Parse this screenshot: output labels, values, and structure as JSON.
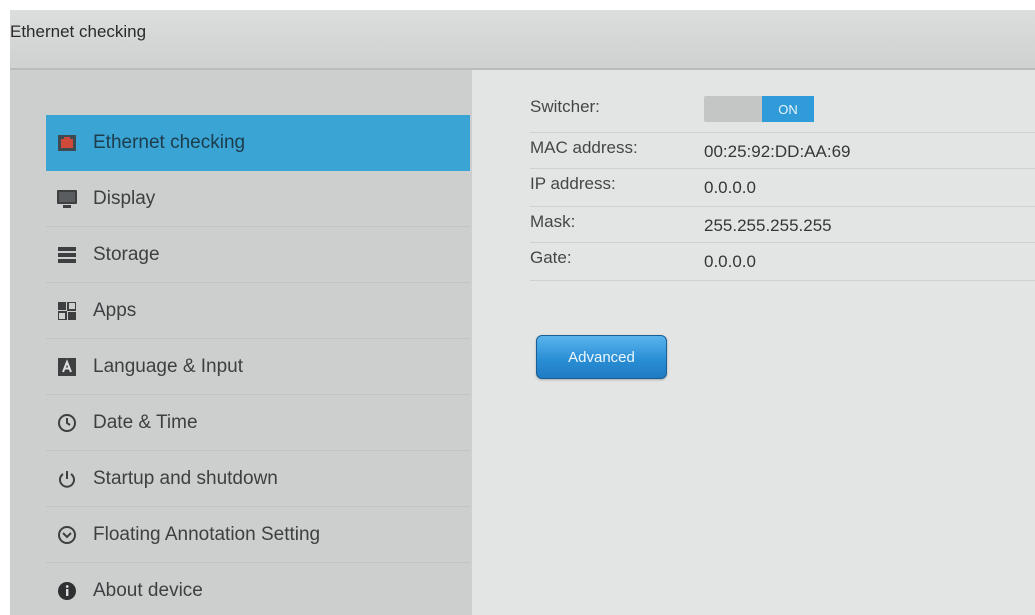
{
  "window": {
    "title": "Ethernet checking"
  },
  "sidebar": {
    "items": [
      {
        "label": "Ethernet checking",
        "icon": "ethernet-icon",
        "active": true
      },
      {
        "label": "Display",
        "icon": "display-icon",
        "active": false
      },
      {
        "label": "Storage",
        "icon": "storage-icon",
        "active": false
      },
      {
        "label": "Apps",
        "icon": "apps-icon",
        "active": false
      },
      {
        "label": "Language & Input",
        "icon": "language-icon",
        "active": false
      },
      {
        "label": "Date & Time",
        "icon": "clock-icon",
        "active": false
      },
      {
        "label": "Startup and shutdown",
        "icon": "power-icon",
        "active": false
      },
      {
        "label": "Floating Annotation Setting",
        "icon": "chevron-circle-icon",
        "active": false
      },
      {
        "label": "About device",
        "icon": "info-icon",
        "active": false
      }
    ]
  },
  "ethernet": {
    "switcher": {
      "label": "Switcher:",
      "state": "ON"
    },
    "fields": [
      {
        "label": "MAC address:",
        "value": "00:25:92:DD:AA:69"
      },
      {
        "label": "IP address:",
        "value": "0.0.0.0"
      },
      {
        "label": "Mask:",
        "value": "255.255.255.255"
      },
      {
        "label": "Gate:",
        "value": "0.0.0.0"
      }
    ],
    "advanced_label": "Advanced"
  },
  "colors": {
    "accent": "#3aa4d4",
    "toggle_on": "#2f9bd8",
    "button": "#2a8fd6"
  }
}
